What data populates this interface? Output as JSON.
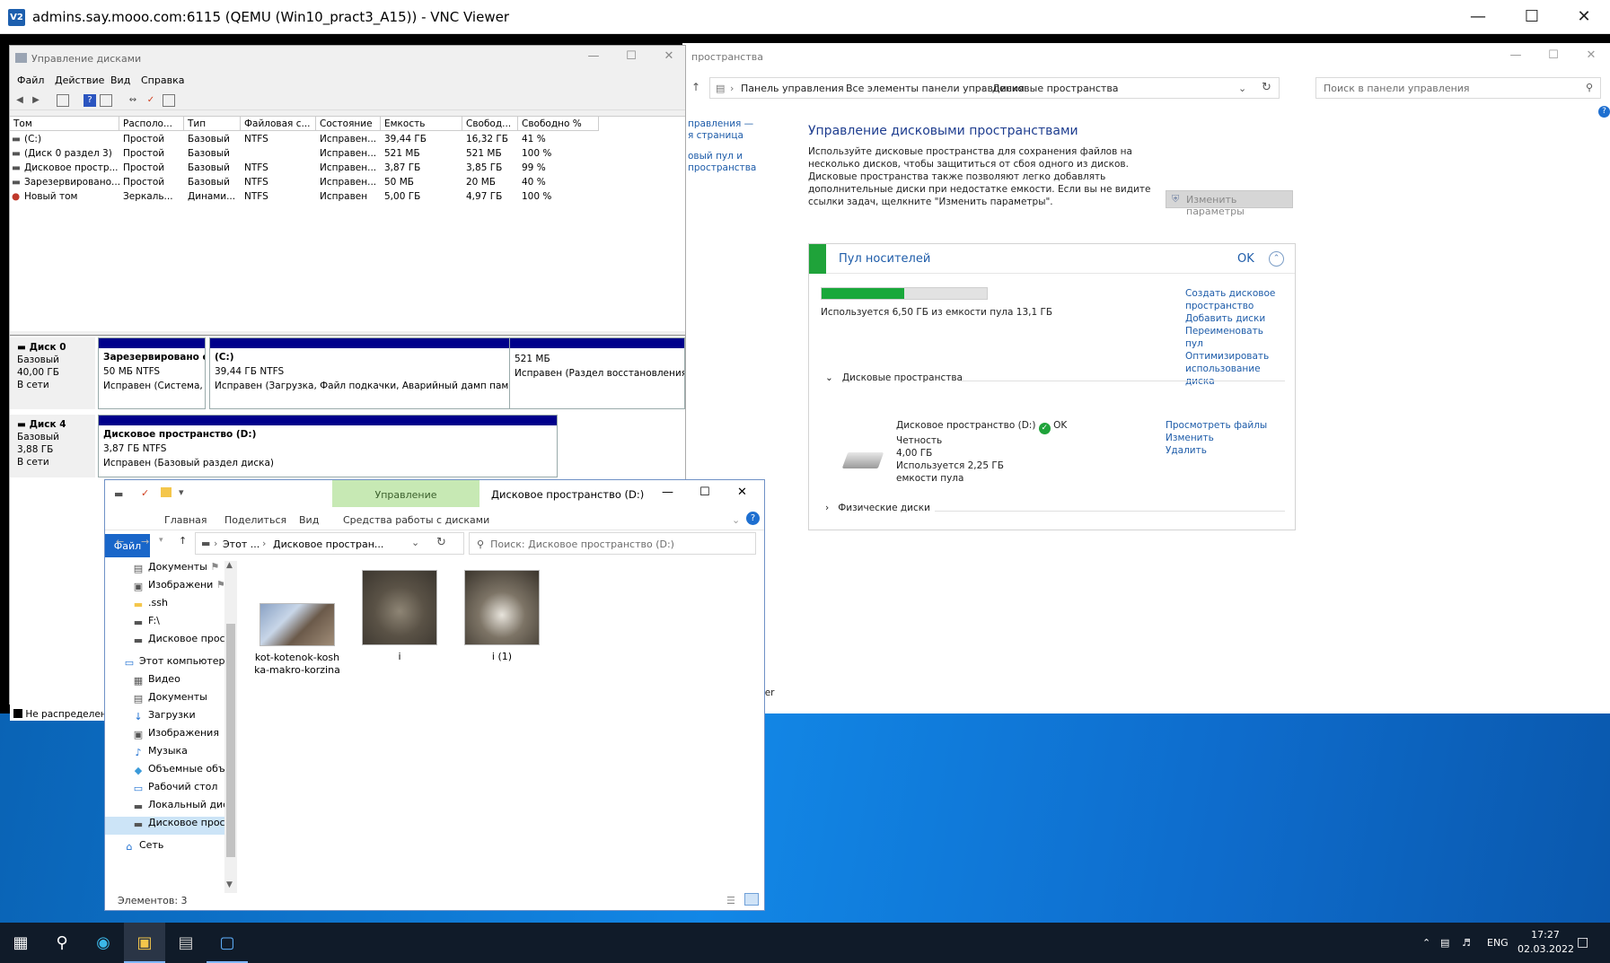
{
  "vnc": {
    "title": "admins.say.mooo.com:6115 (QEMU (Win10_pract3_A15)) - VNC Viewer",
    "logo": "V2"
  },
  "control_panel": {
    "title_fragment": "пространства",
    "breadcrumb": [
      "Панель управления",
      "Все элементы панели управления",
      "Дисковые пространства"
    ],
    "search_placeholder": "Поиск в панели управления",
    "left_links": [
      "правления —",
      "я страница",
      "овый пул и",
      "пространства"
    ],
    "left_bottom": "ker",
    "heading": "Управление дисковыми пространствами",
    "description": "Используйте дисковые пространства для сохранения файлов на несколько дисков, чтобы защититься от сбоя одного из дисков. Дисковые пространства также позволяют легко добавлять дополнительные диски при недостатке емкости. Если вы не видите ссылки задач, щелкните \"Изменить параметры\".",
    "change_settings": "Изменить параметры",
    "pool": {
      "name": "Пул носителей",
      "status": "OK",
      "usage_fraction": 0.5,
      "usage_text": "Используется 6,50 ГБ из емкости пула 13,1 ГБ",
      "actions": [
        "Создать дисковое пространство",
        "Добавить диски",
        "Переименовать пул",
        "Оптимизировать использование диска"
      ],
      "spaces_section": "Дисковые пространства",
      "space": {
        "name": "Дисковое пространство (D:)",
        "status": "OK",
        "resiliency": "Четность",
        "size": "4,00 ГБ",
        "used": "Используется 2,25 ГБ",
        "used2": "емкости пула",
        "actions": [
          "Просмотреть файлы",
          "Изменить",
          "Удалить"
        ]
      },
      "physical_section": "Физические диски"
    }
  },
  "disk_mgmt": {
    "title": "Управление дисками",
    "menu": [
      "Файл",
      "Действие",
      "Вид",
      "Справка"
    ],
    "columns": [
      "Том",
      "Располо...",
      "Тип",
      "Файловая с...",
      "Состояние",
      "Емкость",
      "Свобод...",
      "Свободно %"
    ],
    "rows": [
      [
        "(C:)",
        "Простой",
        "Базовый",
        "NTFS",
        "Исправен...",
        "39,44 ГБ",
        "16,32 ГБ",
        "41 %"
      ],
      [
        "(Диск 0 раздел 3)",
        "Простой",
        "Базовый",
        "",
        "Исправен...",
        "521 МБ",
        "521 МБ",
        "100 %"
      ],
      [
        "Дисковое простр...",
        "Простой",
        "Базовый",
        "NTFS",
        "Исправен...",
        "3,87 ГБ",
        "3,85 ГБ",
        "99 %"
      ],
      [
        "Зарезервировано...",
        "Простой",
        "Базовый",
        "NTFS",
        "Исправен...",
        "50 МБ",
        "20 МБ",
        "40 %"
      ],
      [
        "Новый том",
        "Зеркаль...",
        "Динами...",
        "NTFS",
        "Исправен",
        "5,00 ГБ",
        "4,97 ГБ",
        "100 %"
      ]
    ],
    "disks": [
      {
        "name": "Диск 0",
        "type": "Базовый",
        "size": "40,00 ГБ",
        "state": "В сети",
        "parts": [
          {
            "name": "Зарезервировано с",
            "size": "50 МБ NTFS",
            "status": "Исправен (Система, ."
          },
          {
            "name": "(C:)",
            "size": "39,44 ГБ NTFS",
            "status": "Исправен (Загрузка, Файл подкачки, Аварийный дамп памяти"
          },
          {
            "name": "",
            "size": "521 МБ",
            "status": "Исправен (Раздел восстановления)"
          }
        ]
      },
      {
        "name": "Диск 4",
        "type": "Базовый",
        "size": "3,88 ГБ",
        "state": "В сети",
        "parts": [
          {
            "name": "Дисковое пространство  (D:)",
            "size": "3,87 ГБ NTFS",
            "status": "Исправен (Базовый раздел диска)"
          }
        ]
      }
    ],
    "legend": "Не распределена"
  },
  "explorer": {
    "title": "Дисковое пространство (D:)",
    "manage_tab": "Управление",
    "tabs": [
      "Файл",
      "Главная",
      "Поделиться",
      "Вид",
      "Средства работы с дисками"
    ],
    "address": [
      "Этот ...",
      "Дисковое простран..."
    ],
    "search_placeholder": "Поиск: Дисковое пространство (D:)",
    "nav": [
      {
        "label": "Документы",
        "icon": "documents-icon"
      },
      {
        "label": "Изображени",
        "icon": "pictures-icon"
      },
      {
        "label": ".ssh",
        "icon": "folder-icon"
      },
      {
        "label": "F:\\",
        "icon": "drive-icon"
      },
      {
        "label": "Дисковое прост",
        "icon": "drive-icon"
      },
      {
        "label": "Этот компьютер",
        "icon": "computer-icon"
      },
      {
        "label": "Видео",
        "icon": "video-icon"
      },
      {
        "label": "Документы",
        "icon": "documents-icon"
      },
      {
        "label": "Загрузки",
        "icon": "downloads-icon"
      },
      {
        "label": "Изображения",
        "icon": "pictures-icon"
      },
      {
        "label": "Музыка",
        "icon": "music-icon"
      },
      {
        "label": "Объемные объ",
        "icon": "3d-objects-icon"
      },
      {
        "label": "Рабочий стол",
        "icon": "desktop-icon"
      },
      {
        "label": "Локальный дис",
        "icon": "drive-icon"
      },
      {
        "label": "Дисковое прост",
        "icon": "drive-icon"
      },
      {
        "label": "Сеть",
        "icon": "network-icon"
      }
    ],
    "files": [
      "kot-kotenok-koshka-makro-korzina",
      "i",
      "i (1)"
    ],
    "status": "Элементов: 3"
  },
  "taskbar": {
    "lang": "ENG",
    "time": "17:27",
    "date": "02.03.2022"
  }
}
